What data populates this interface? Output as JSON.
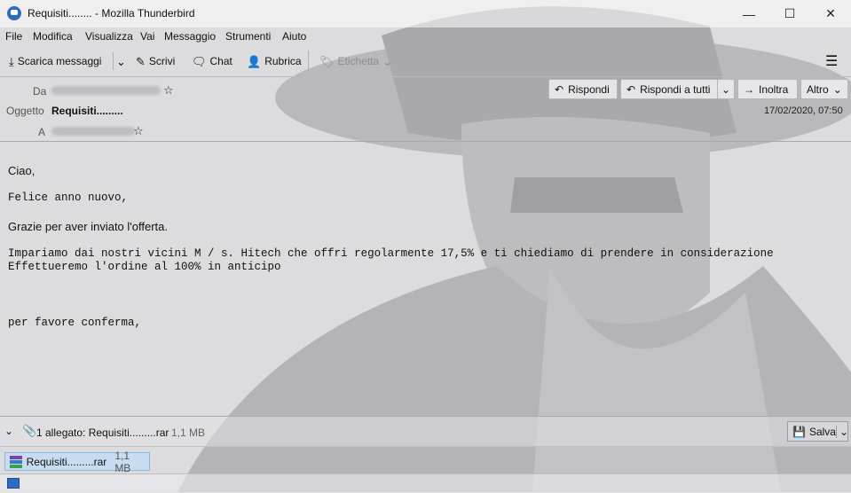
{
  "window": {
    "title": "Requisiti........ - Mozilla Thunderbird",
    "minimize": "—",
    "maximize": "☐",
    "close": "✕"
  },
  "menu": [
    "File",
    "Modifica",
    "Visualizza",
    "Vai",
    "Messaggio",
    "Strumenti",
    "Aiuto"
  ],
  "toolbar": {
    "get_messages": "Scarica messaggi",
    "write": "Scrivi",
    "chat": "Chat",
    "address_book": "Rubrica",
    "tag": "Etichetta",
    "menu_icon": "hamburger-icon"
  },
  "header": {
    "from_label": "Da",
    "subject_label": "Oggetto",
    "subject": "Requisiti.........",
    "to_label": "A",
    "date": "17/02/2020, 07:50",
    "reply": "Rispondi",
    "reply_all": "Rispondi a tutti",
    "forward": "Inoltra",
    "more": "Altro"
  },
  "message": {
    "greeting": "Ciao,",
    "line1": "Felice anno nuovo,",
    "line2": "Grazie per aver inviato l'offerta.",
    "line3": "Impariamo dai nostri vicini M / s. Hitech che offri regolarmente 17,5% e ti chiediamo di prendere in considerazione",
    "line4": "Effettueremo l'ordine al 100% in anticipo",
    "closing": "per favore conferma,"
  },
  "attachments": {
    "summary": "1 allegato: Requisiti.........rar",
    "summary_size": "1,1 MB",
    "save": "Salva",
    "items": [
      {
        "name": "Requisiti.........rar",
        "size": "1,1 MB"
      }
    ]
  },
  "colors": {
    "accent": "#2b6cc4",
    "selection": "#c3dcf5"
  }
}
